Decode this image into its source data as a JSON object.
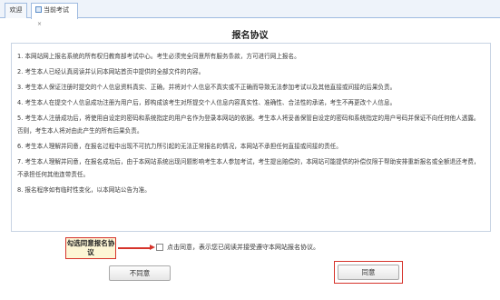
{
  "tabs": [
    {
      "label": "欢迎"
    },
    {
      "label": "当前考试",
      "close": "×"
    }
  ],
  "page": {
    "title": "报名协议"
  },
  "terms": [
    "1. 本网站网上报名系统的所有权归教育部考试中心。考生必须完全同意所有服务条款，方可进行网上报名。",
    "2. 考生本人已经认真阅读并认同本网站首页中提供的全部文件的内容。",
    "3. 考生本人保证注册时提交的个人信息资料真实、正确，并将对个人信息不真实或不正确而导致无法参加考试以及其他直接或间接的后果负责。",
    "4. 考生本人在提交个人信息成功注册为用户后，即构成该考生对所提交个人信息内容真实性、准确性、合法性的承诺，考生不再更改个人信息。",
    "5. 考生本人注册成功后，将使用自设定的密码和系统指定的用户名作为登录本网站的依据。考生本人将妥善保管自设定的密码和系统指定的用户号码并保证不向任何他人透露。否则，考生本人将对由此产生的所有后果负责。",
    "6. 考生本人理解并同意，在报名过程中出现不可抗力所引起的无法正常报名的情况，本网站不承担任何直接或间接的责任。",
    "7. 考生本人理解并同意，在报名成功后，由于本网站系统出现问题影响考生本人参加考试，考生提出赔偿的，本网站可能提供的补偿仅限于帮助安排重新报名或全额退还考费，不承担任何其他连带责任。",
    "8. 报名程序如有临时性变化，以本网站公告为准。"
  ],
  "agreement": {
    "callout": "勾选同意报名协议",
    "checkbox_label": "点击同意，表示您已阅读并接受遵守本网站报名协议。",
    "checked": false
  },
  "buttons": {
    "disagree": "不同意",
    "agree": "同意"
  },
  "colors": {
    "highlight": "#d6332b",
    "panel_border": "#c8d4e3",
    "tab_border": "#9fbbe0"
  }
}
